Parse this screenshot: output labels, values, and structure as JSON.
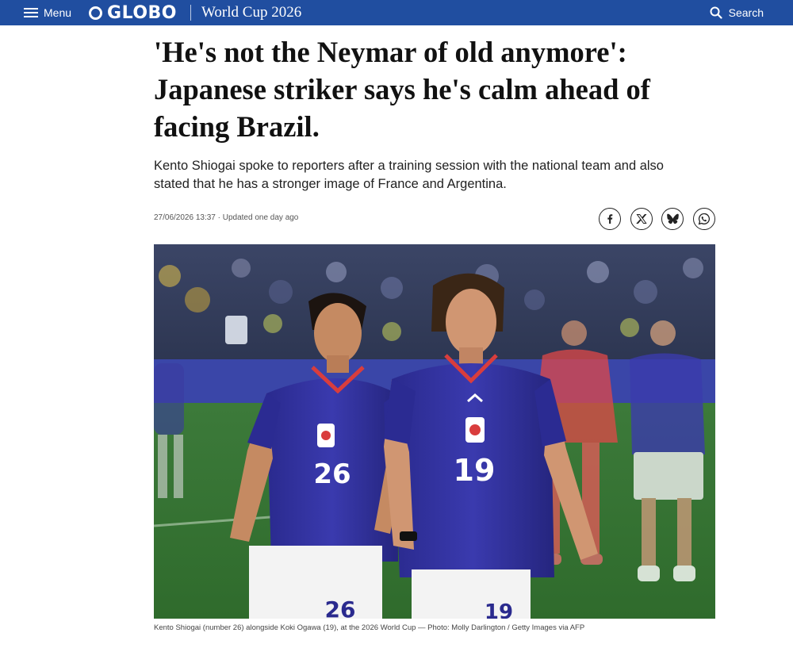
{
  "header": {
    "menu_label": "Menu",
    "logo_text": "GLOBO",
    "section": "World Cup 2026",
    "search_label": "Search",
    "bar_color": "#204ea0"
  },
  "article": {
    "headline": "'He's not the Neymar of old anymore': Japanese striker says he's calm ahead of facing Brazil.",
    "subtitle": "Kento Shiogai spoke to reporters after a training session with the national team and also stated that he has a stronger image of France and Argentina.",
    "timestamp": "27/06/2026 13:37 · Updated one day ago",
    "share_icons": [
      "facebook-icon",
      "x-icon",
      "bluesky-icon",
      "whatsapp-icon"
    ],
    "photo": {
      "player_left_number": "26",
      "player_right_number": "19",
      "caption": "Kento Shiogai (number 26) alongside Koki Ogawa (19), at the 2026 World Cup — Photo: Molly Darlington / Getty Images via AFP"
    }
  }
}
